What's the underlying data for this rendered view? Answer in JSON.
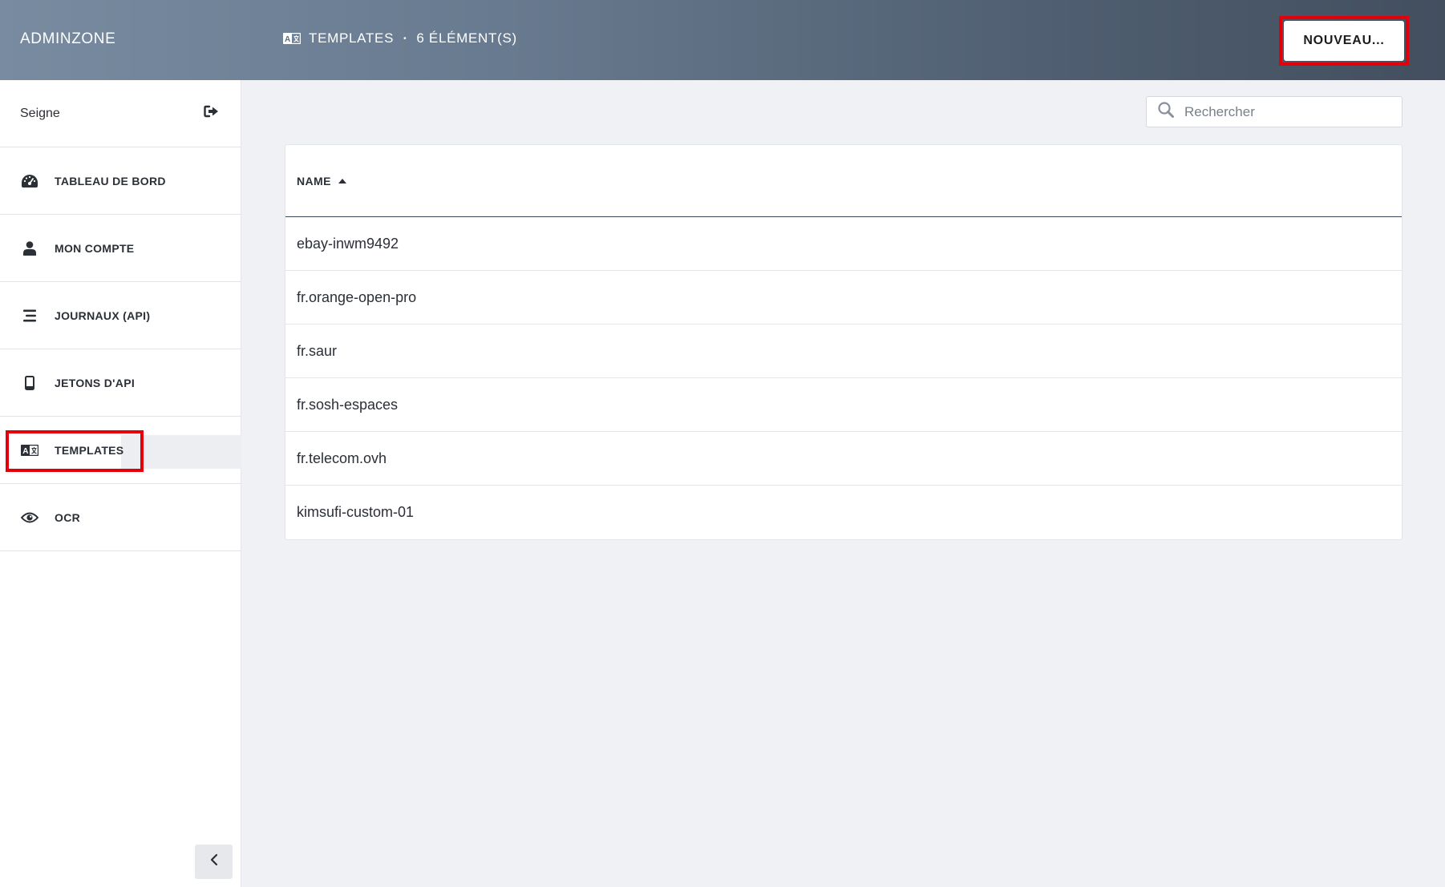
{
  "header": {
    "brand": "ADMINZONE",
    "section_title": "TEMPLATES",
    "separator": "•",
    "count_label": "6 ÉLÉMENT(S)",
    "new_button_label": "NOUVEAU..."
  },
  "sidebar": {
    "user_name": "Seigne",
    "items": [
      {
        "label": "TABLEAU DE BORD",
        "icon": "dashboard-icon"
      },
      {
        "label": "MON COMPTE",
        "icon": "user-icon"
      },
      {
        "label": "JOURNAUX (API)",
        "icon": "list-icon"
      },
      {
        "label": "JETONS D'API",
        "icon": "mobile-icon"
      },
      {
        "label": "TEMPLATES",
        "icon": "language-icon",
        "active": true
      },
      {
        "label": "OCR",
        "icon": "eye-icon"
      }
    ]
  },
  "search": {
    "placeholder": "Rechercher"
  },
  "table": {
    "column_header": "NAME",
    "sort": "ascending",
    "rows": [
      "ebay-inwm9492",
      "fr.orange-open-pro",
      "fr.saur",
      "fr.sosh-espaces",
      "fr.telecom.ovh",
      "kimsufi-custom-01"
    ]
  },
  "colors": {
    "highlight_border": "#e3000b",
    "header_gradient_start": "#798ba0",
    "header_gradient_end": "#434f5f"
  }
}
